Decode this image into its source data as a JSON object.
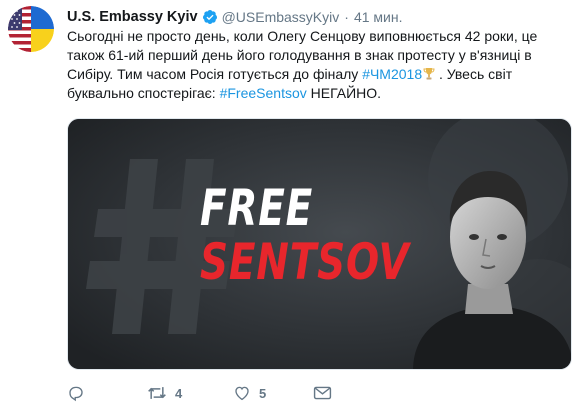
{
  "tweet": {
    "name": "U.S. Embassy Kyiv",
    "handle": "@USEmbassyKyiv",
    "separator": "·",
    "time": "41 мин.",
    "text": {
      "line1": "Сьогодні не просто день, коли Олегу Сенцову виповнюється 42 роки, це",
      "line2": "також 61-ий перший день його голодування в знак протесту у в'язниці в",
      "line3_before": "Сибіру. Тим часом Росія готується до фіналу ",
      "line3_hashtag": "#ЧМ2018",
      "line3_after": " . Увесь світ",
      "line4_before": "буквально спостерігає: ",
      "line4_hashtag": "#FreeSentsov",
      "line4_after": " НЕГАЙНО."
    },
    "media": {
      "line1": "FREE",
      "line2": "SENTSOV"
    },
    "actions": {
      "retweets": "4",
      "likes": "5"
    }
  },
  "colors": {
    "link": "#1b95e0",
    "meta": "#657786",
    "verified": "#1da1f2",
    "media_red": "#e8262c"
  },
  "icons": {
    "avatar": "us-ukraine-flag-avatar",
    "verified": "verified-badge-icon",
    "trophy": "trophy-icon",
    "reply": "reply-icon",
    "retweet": "retweet-icon",
    "like": "heart-icon",
    "dm": "envelope-icon"
  }
}
